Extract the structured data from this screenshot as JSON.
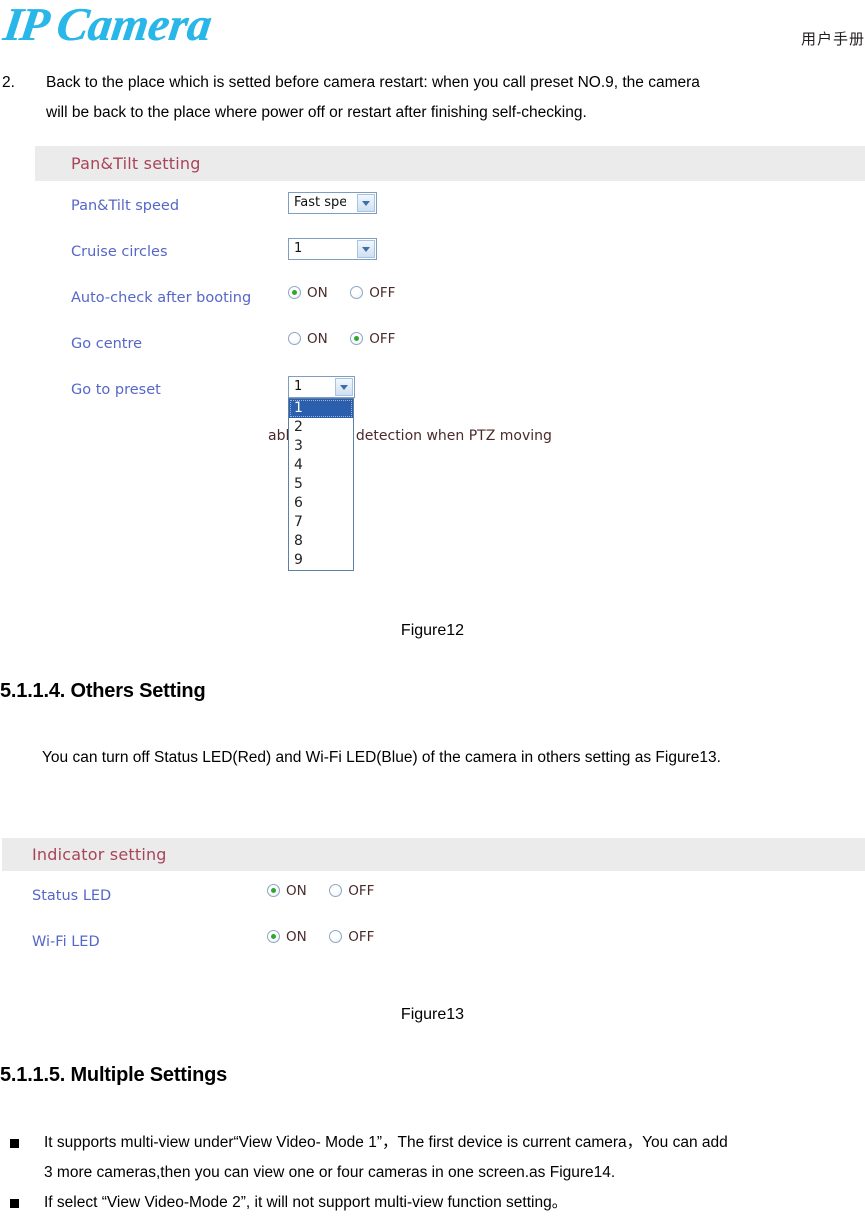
{
  "header": {
    "logo_part1": "IP",
    "logo_part2": "Camera",
    "manual_label": "用户手册",
    "logo_color": "#29b6e8"
  },
  "numbered_item": {
    "number": "2.",
    "line1": "Back to the place which is setted before camera restart: when you call preset NO.9, the camera",
    "line2": "will be back to the place where power off or restart after finishing self-checking."
  },
  "pan_tilt_panel": {
    "title": "Pan&Tilt setting",
    "title_color": "#a8445a",
    "rows": [
      {
        "label": "Pan&Tilt speed",
        "control": "select",
        "value": "Fast speed"
      },
      {
        "label": "Cruise circles",
        "control": "select",
        "value": "1"
      },
      {
        "label": "Auto-check after booting",
        "control": "radio",
        "options": [
          "ON",
          "OFF"
        ],
        "selected": "ON"
      },
      {
        "label": "Go centre",
        "control": "radio",
        "options": [
          "ON",
          "OFF"
        ],
        "selected": "OFF"
      },
      {
        "label": "Go to preset",
        "control": "select",
        "value": "1"
      }
    ],
    "dropdown_open": {
      "options": [
        "1",
        "2",
        "3",
        "4",
        "5",
        "6",
        "7",
        "8",
        "9"
      ],
      "highlighted": "1"
    },
    "obscured_text": "able motion detection when PTZ moving"
  },
  "figure12_caption": "Figure12",
  "others_section": {
    "heading": "5.1.1.4. Others Setting",
    "paragraph": "You can turn off Status LED(Red) and Wi-Fi LED(Blue) of the camera in others setting as Figure13."
  },
  "indicator_panel": {
    "title": "Indicator setting",
    "title_color": "#a8445a",
    "rows": [
      {
        "label": "Status LED",
        "options": [
          "ON",
          "OFF"
        ],
        "selected": "ON"
      },
      {
        "label": "Wi-Fi LED",
        "options": [
          "ON",
          "OFF"
        ],
        "selected": "ON"
      }
    ]
  },
  "figure13_caption": "Figure13",
  "multiple_section": {
    "heading": "5.1.1.5. Multiple Settings",
    "bullets": [
      {
        "line1": "It supports multi-view under“View Video- Mode 1”，The first device is current camera，You can add",
        "line2": "3 more cameras,then you can view one or four cameras in one screen.as Figure14."
      },
      {
        "line1": "If select  “View Video-Mode 2”, it will not support multi-view function setting。",
        "line2": ""
      }
    ]
  }
}
